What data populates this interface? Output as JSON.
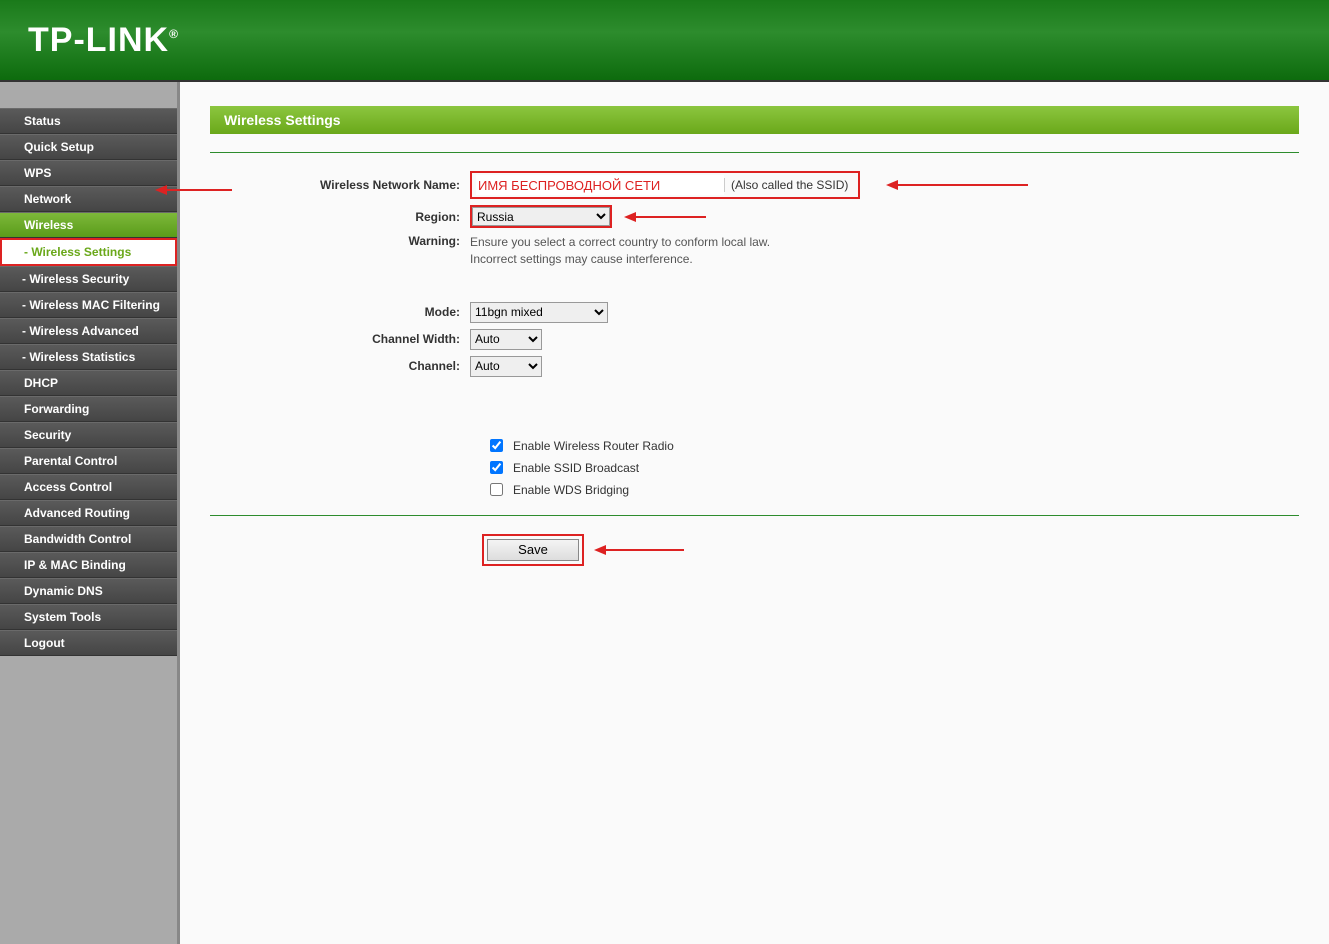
{
  "brand": "TP-LINK",
  "nav": {
    "items": [
      {
        "label": "Status"
      },
      {
        "label": "Quick Setup"
      },
      {
        "label": "WPS"
      },
      {
        "label": "Network"
      },
      {
        "label": "Wireless",
        "active_parent": true
      },
      {
        "label": "- Wireless Settings",
        "active_sub": true
      },
      {
        "label": "- Wireless Security"
      },
      {
        "label": "- Wireless MAC Filtering"
      },
      {
        "label": "- Wireless Advanced"
      },
      {
        "label": "- Wireless Statistics"
      },
      {
        "label": "DHCP"
      },
      {
        "label": "Forwarding"
      },
      {
        "label": "Security"
      },
      {
        "label": "Parental Control"
      },
      {
        "label": "Access Control"
      },
      {
        "label": "Advanced Routing"
      },
      {
        "label": "Bandwidth Control"
      },
      {
        "label": "IP & MAC Binding"
      },
      {
        "label": "Dynamic DNS"
      },
      {
        "label": "System Tools"
      },
      {
        "label": "Logout"
      }
    ]
  },
  "page": {
    "title": "Wireless Settings",
    "ssid_label": "Wireless Network Name:",
    "ssid_value": "ИМЯ БЕСПРОВОДНОЙ СЕТИ",
    "ssid_hint": "(Also called the SSID)",
    "region_label": "Region:",
    "region_value": "Russia",
    "warning_label": "Warning:",
    "warning_text1": "Ensure you select a correct country to conform local law.",
    "warning_text2": "Incorrect settings may cause interference.",
    "mode_label": "Mode:",
    "mode_value": "11bgn mixed",
    "cw_label": "Channel Width:",
    "cw_value": "Auto",
    "channel_label": "Channel:",
    "channel_value": "Auto",
    "chk1": "Enable Wireless Router Radio",
    "chk2": "Enable SSID Broadcast",
    "chk3": "Enable WDS Bridging",
    "save": "Save"
  }
}
